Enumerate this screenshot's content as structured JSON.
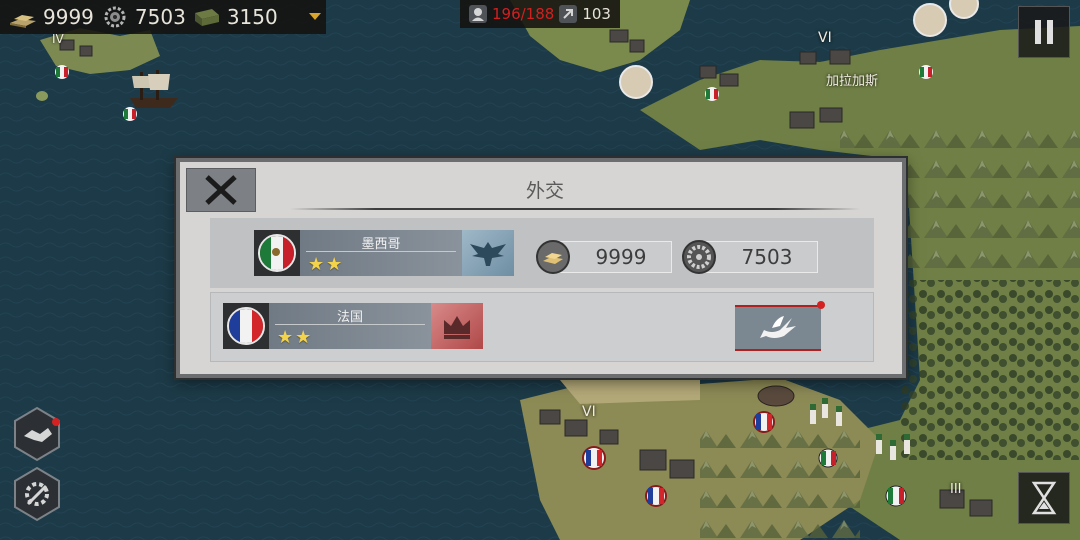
{
  "resources": {
    "gold": {
      "icon": "gold-bars-icon",
      "value": "9999"
    },
    "industry": {
      "icon": "gear-icon",
      "value": "7503"
    },
    "food": {
      "icon": "supplies-icon",
      "value": "3150"
    }
  },
  "army": {
    "count": "196/188",
    "supply": "103"
  },
  "map": {
    "city_label": "加拉加斯",
    "city_levels": [
      "IV",
      "VI",
      "VI",
      "III"
    ]
  },
  "dialog": {
    "title": "外交",
    "player_nation": {
      "name": "墨西哥",
      "stars": "★★",
      "flag_colors": [
        "#1e7a38",
        "#f2f2f2",
        "#c8202a"
      ],
      "emblem": "eagle-emblem-icon"
    },
    "player_gold": "9999",
    "player_industry": "7503",
    "other_nation": {
      "name": "法国",
      "stars": "★★",
      "flag_colors": [
        "#1f3e9c",
        "#f2f2f2",
        "#d3262b"
      ],
      "emblem": "crown-emblem-icon"
    },
    "action": {
      "icon": "peace-dove-icon"
    }
  },
  "colors": {
    "accent_red": "#d42222",
    "panel": "#d6d5d3"
  }
}
